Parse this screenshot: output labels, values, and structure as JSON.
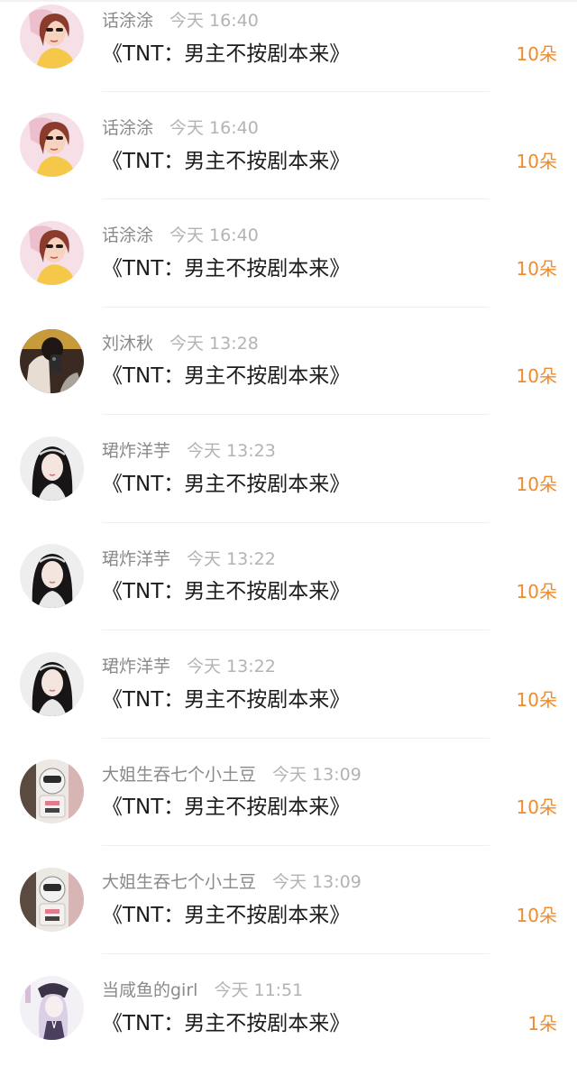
{
  "gifts": [
    {
      "user": "话涂涂",
      "time": "今天 16:40",
      "title": "《TNT：男主不按剧本来》",
      "amount": "10朵",
      "avatar": "girl-sunglasses-avatar"
    },
    {
      "user": "话涂涂",
      "time": "今天 16:40",
      "title": "《TNT：男主不按剧本来》",
      "amount": "10朵",
      "avatar": "girl-sunglasses-avatar"
    },
    {
      "user": "话涂涂",
      "time": "今天 16:40",
      "title": "《TNT：男主不按剧本来》",
      "amount": "10朵",
      "avatar": "girl-sunglasses-avatar"
    },
    {
      "user": "刘沐秋",
      "time": "今天 13:28",
      "title": "《TNT：男主不按剧本来》",
      "amount": "10朵",
      "avatar": "mirror-selfie-avatar"
    },
    {
      "user": "珺炸洋芋",
      "time": "今天 13:23",
      "title": "《TNT：男主不按剧本来》",
      "amount": "10朵",
      "avatar": "girl-headband-avatar"
    },
    {
      "user": "珺炸洋芋",
      "time": "今天 13:22",
      "title": "《TNT：男主不按剧本来》",
      "amount": "10朵",
      "avatar": "girl-headband-avatar"
    },
    {
      "user": "珺炸洋芋",
      "time": "今天 13:22",
      "title": "《TNT：男主不按剧本来》",
      "amount": "10朵",
      "avatar": "girl-headband-avatar"
    },
    {
      "user": "大姐生吞七个小土豆",
      "time": "今天 13:09",
      "title": "《TNT：男主不按剧本来》",
      "amount": "10朵",
      "avatar": "helmet-character-avatar"
    },
    {
      "user": "大姐生吞七个小土豆",
      "time": "今天 13:09",
      "title": "《TNT：男主不按剧本来》",
      "amount": "10朵",
      "avatar": "helmet-character-avatar"
    },
    {
      "user": "当咸鱼的girl",
      "time": "今天 11:51",
      "title": "《TNT：男主不按剧本来》",
      "amount": "1朵",
      "avatar": "anime-girl-avatar"
    }
  ],
  "colors": {
    "amount": "#f08a2a",
    "username": "#8a8a8a",
    "time": "#b3b3b3",
    "title": "#1c1c1c",
    "divider": "#efefef"
  }
}
